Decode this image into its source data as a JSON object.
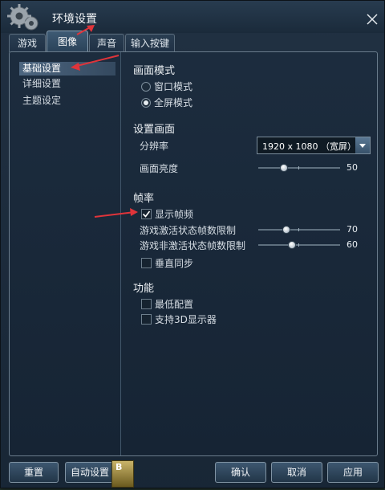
{
  "window": {
    "title": "环境设置"
  },
  "tabs": [
    {
      "label": "游戏",
      "active": false
    },
    {
      "label": "图像",
      "active": true
    },
    {
      "label": "声音",
      "active": false
    },
    {
      "label": "输入按键",
      "active": false
    }
  ],
  "sidebar": {
    "items": [
      {
        "label": "基础设置",
        "active": true
      },
      {
        "label": "详细设置",
        "active": false
      },
      {
        "label": "主题设定",
        "active": false
      }
    ]
  },
  "display_mode": {
    "title": "画面模式",
    "windowed": {
      "label": "窗口模式",
      "selected": false
    },
    "fullscreen": {
      "label": "全屏模式",
      "selected": true
    }
  },
  "screen": {
    "title": "设置画面",
    "resolution_label": "分辨率",
    "resolution_value": "1920 x 1080 （宽屏）",
    "brightness_label": "画面亮度",
    "brightness_value": "50",
    "brightness_fraction": 0.3
  },
  "framerate": {
    "title": "帧率",
    "show_fps": {
      "label": "显示帧频",
      "checked": true
    },
    "active_limit": {
      "label": "游戏激活状态帧数限制",
      "value": "70",
      "fraction": 0.33
    },
    "inactive_limit": {
      "label": "游戏非激活状态帧数限制",
      "value": "60",
      "fraction": 0.4
    },
    "vsync": {
      "label": "垂直同步",
      "checked": false
    }
  },
  "features": {
    "title": "功能",
    "lowest_config": {
      "label": "最低配置",
      "checked": false
    },
    "support_3d": {
      "label": "支持3D显示器",
      "checked": false
    }
  },
  "footer": {
    "reset_label": "重置",
    "auto_label": "自动设置",
    "badge_label": "B",
    "confirm_label": "确认",
    "cancel_label": "取消",
    "apply_label": "应用"
  },
  "colors": {
    "annotation_arrow": "#e0343a"
  }
}
